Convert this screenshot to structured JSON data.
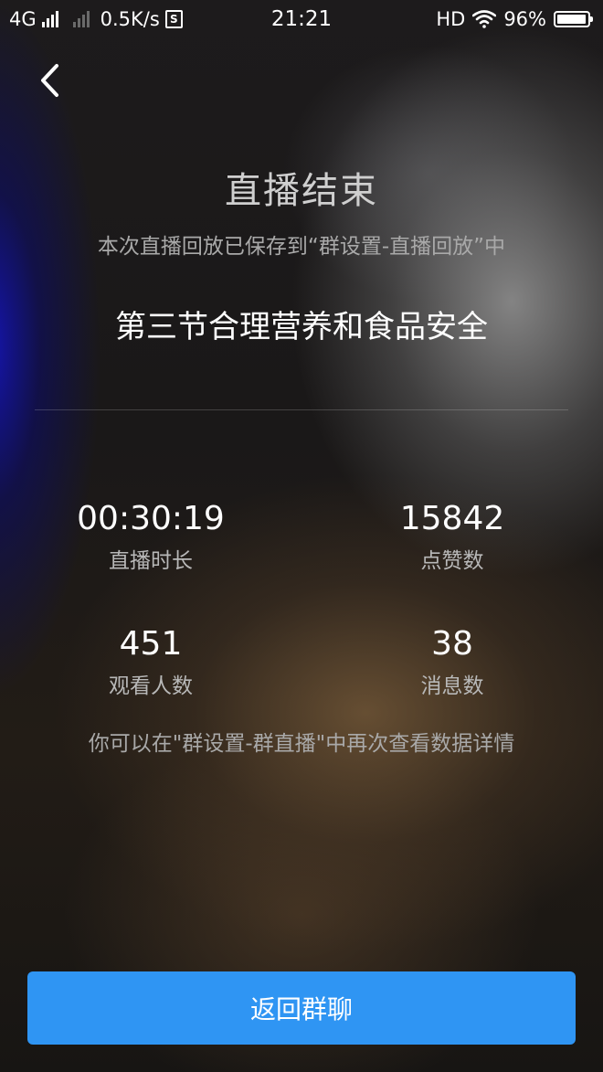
{
  "status_bar": {
    "network": "4G",
    "speed": "0.5K/s",
    "sim_icon": "S",
    "time": "21:21",
    "hd": "HD",
    "battery": "96%",
    "battery_level": 0.96
  },
  "header": {
    "title": "直播结束",
    "subtitle": "本次直播回放已保存到“群设置-直播回放”中"
  },
  "live": {
    "name": "第三节合理营养和食品安全"
  },
  "stats": {
    "duration": {
      "value": "00:30:19",
      "label": "直播时长"
    },
    "likes": {
      "value": "15842",
      "label": "点赞数"
    },
    "viewers": {
      "value": "451",
      "label": "观看人数"
    },
    "messages": {
      "value": "38",
      "label": "消息数"
    }
  },
  "hint": "你可以在\"群设置-群直播\"中再次查看数据详情",
  "actions": {
    "return_label": "返回群聊"
  },
  "colors": {
    "primary_button": "#2f95f3"
  }
}
